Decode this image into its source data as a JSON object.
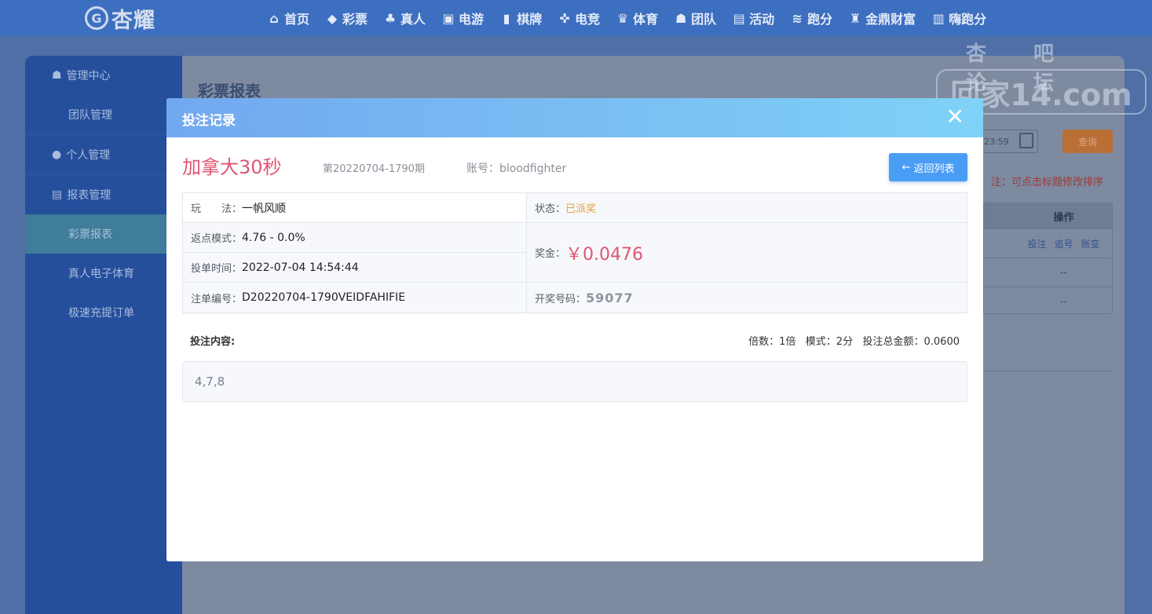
{
  "brand": {
    "name": "杏耀"
  },
  "nav": [
    {
      "icon": "home-icon",
      "glyph": "⌂",
      "label": "首页"
    },
    {
      "icon": "lottery-icon",
      "glyph": "◆",
      "label": "彩票"
    },
    {
      "icon": "live-dealer-icon",
      "glyph": "♣",
      "label": "真人"
    },
    {
      "icon": "slots-icon",
      "glyph": "▣",
      "label": "电游"
    },
    {
      "icon": "cards-icon",
      "glyph": "▮",
      "label": "棋牌"
    },
    {
      "icon": "gamepad-icon",
      "glyph": "✜",
      "label": "电竞"
    },
    {
      "icon": "trophy-icon",
      "glyph": "♛",
      "label": "体育"
    },
    {
      "icon": "team-icon",
      "glyph": "☗",
      "label": "团队"
    },
    {
      "icon": "gift-icon",
      "glyph": "▤",
      "label": "活动"
    },
    {
      "icon": "running-icon",
      "glyph": "≋",
      "label": "跑分"
    },
    {
      "icon": "wealth-icon",
      "glyph": "♜",
      "label": "金鼎财富"
    },
    {
      "icon": "hi-icon",
      "glyph": "▥",
      "label": "嗨跑分"
    }
  ],
  "sidebar": {
    "groups": [
      {
        "label": "管理中心",
        "items": [
          "团队管理"
        ]
      },
      {
        "label": "个人管理",
        "items": []
      },
      {
        "label": "报表管理",
        "items": [
          "彩票报表",
          "真人电子体育",
          "极速充提订单"
        ]
      }
    ],
    "active_item": "彩票报表"
  },
  "background_page": {
    "title": "彩票报表",
    "date_value": "23:59",
    "query_label": "查询",
    "note": "注：可点击标题修改排序",
    "table_header": "操作",
    "row_actions": [
      "投注",
      "追号",
      "账变"
    ],
    "empty_cell": "--"
  },
  "watermark": {
    "top": "杏吧 论坛",
    "main": "回家14.com"
  },
  "modal": {
    "title": "投注记录",
    "lottery_name": "加拿大30秒",
    "issue": "第20220704-1790期",
    "account_label": "账号：",
    "account": "bloodfighter",
    "back_label": "返回列表",
    "play_label": "玩　　法：",
    "play_value": "一帆风顺",
    "status_label": "状态：",
    "status_value": "已派奖",
    "rebate_label": "返点模式：",
    "rebate_value": "4.76 - 0.0%",
    "prize_label": "奖金：",
    "prize_value": "￥0.0476",
    "time_label": "投单时间：",
    "time_value": "2022-07-04 14:54:44",
    "order_label": "注单编号：",
    "order_value": "D20220704-1790VEIDFAHIFIE",
    "draw_label": "开奖号码：",
    "draw_value": "59077",
    "content_label": "投注内容:",
    "multiplier_label": "倍数：",
    "multiplier_value": "1倍",
    "mode_label": "模式：",
    "mode_value": "2分",
    "total_label": "投注总金额：",
    "total_value": "0.0600",
    "bet_content": "4,7,8"
  }
}
